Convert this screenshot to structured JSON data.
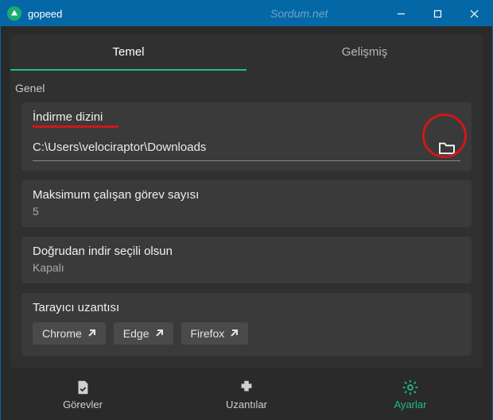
{
  "window": {
    "title": "gopeed",
    "watermark": "Sordum.net"
  },
  "tabs": {
    "basic": "Temel",
    "advanced": "Gelişmiş"
  },
  "section": {
    "general": "Genel"
  },
  "download_dir": {
    "label": "İndirme dizini",
    "value": "C:\\Users\\velociraptor\\Downloads"
  },
  "max_tasks": {
    "label": "Maksimum çalışan görev sayısı",
    "value": "5"
  },
  "direct_download": {
    "label": "Doğrudan indir seçili olsun",
    "value": "Kapalı"
  },
  "extension": {
    "label": "Tarayıcı uzantısı",
    "buttons": {
      "chrome": "Chrome",
      "edge": "Edge",
      "firefox": "Firefox"
    }
  },
  "nav": {
    "tasks": "Görevler",
    "extensions": "Uzantılar",
    "settings": "Ayarlar"
  }
}
